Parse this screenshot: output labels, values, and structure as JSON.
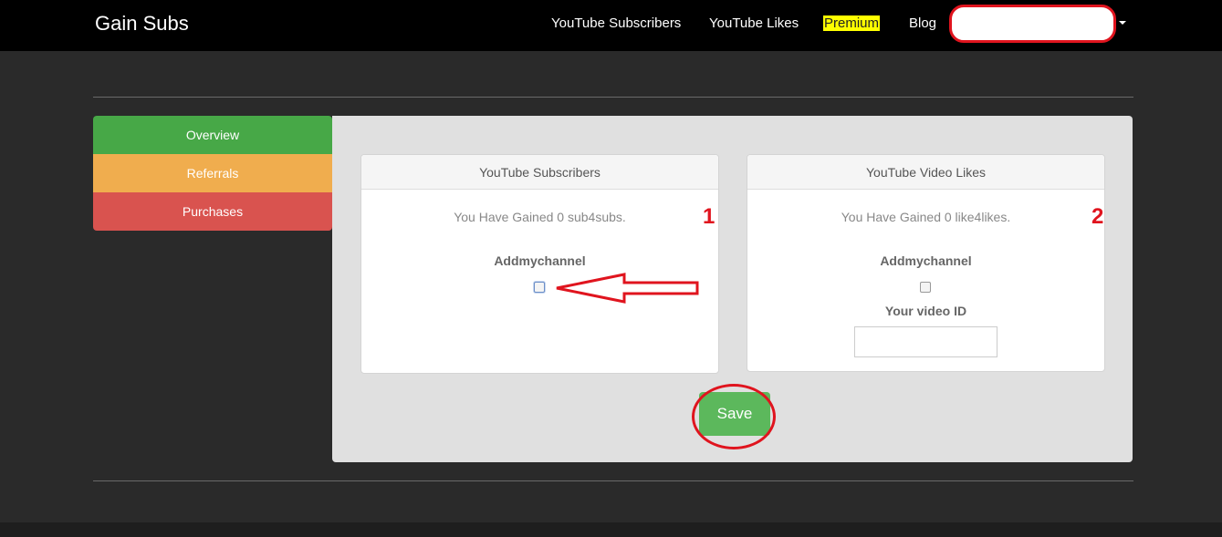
{
  "brand": "Gain Subs",
  "nav": {
    "subscribers": "YouTube Subscribers",
    "likes": "YouTube Likes",
    "premium": "Premium",
    "blog": "Blog"
  },
  "sidebar": {
    "items": [
      {
        "label": "Overview"
      },
      {
        "label": "Referrals"
      },
      {
        "label": "Purchases"
      }
    ]
  },
  "cards": {
    "subscribers": {
      "title": "YouTube Subscribers",
      "gained": "You Have Gained 0 sub4subs.",
      "channel_label": "Addmychannel",
      "marker": "1"
    },
    "likes": {
      "title": "YouTube Video Likes",
      "gained": "You Have Gained 0 like4likes.",
      "channel_label": "Addmychannel",
      "video_id_label": "Your video ID",
      "video_id_value": "",
      "marker": "2"
    }
  },
  "save_label": "Save",
  "colors": {
    "overview": "#47a847",
    "referrals": "#f0ad4e",
    "purchases": "#d9534f",
    "save": "#5cb85c",
    "annotation": "#e0141e",
    "premium_highlight": "#ffff00"
  }
}
